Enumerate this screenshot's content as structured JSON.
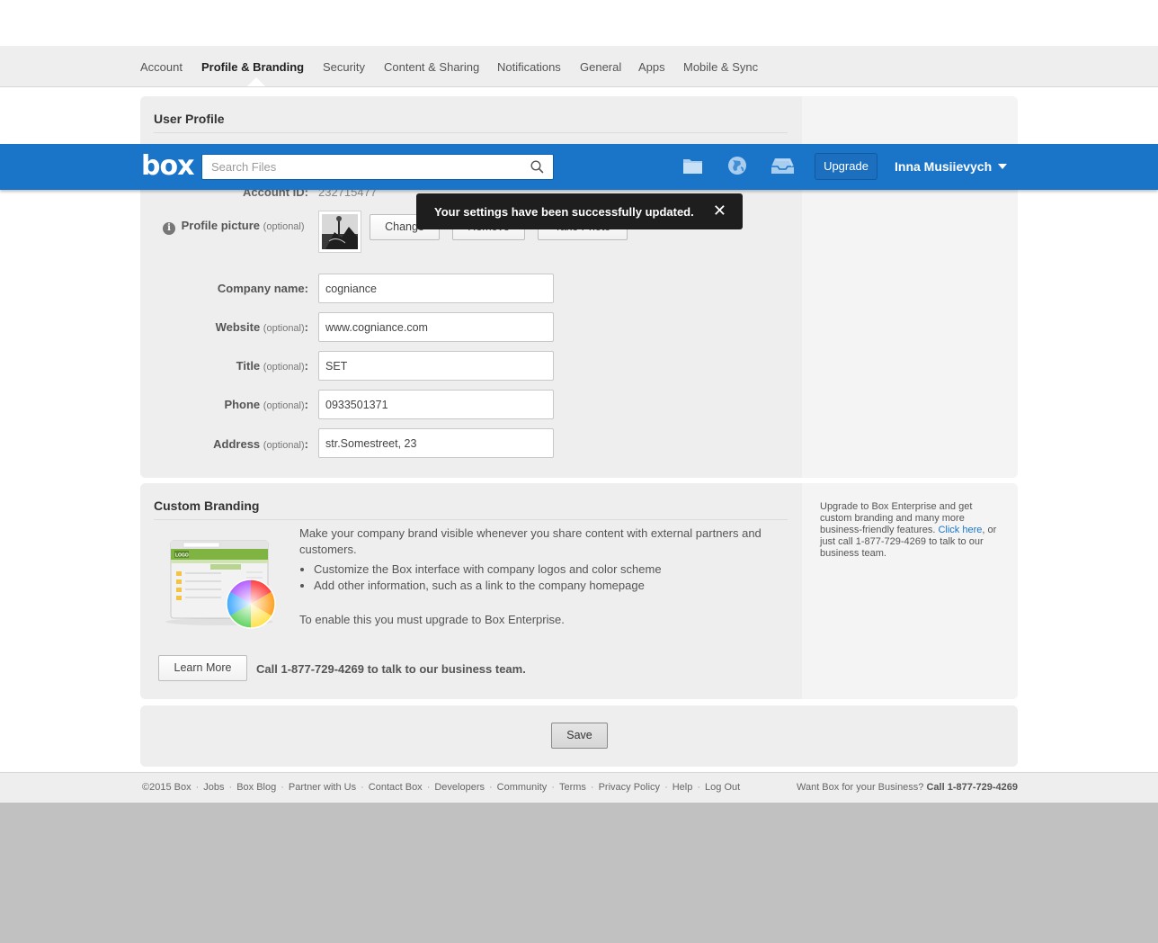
{
  "settings_tabs": [
    {
      "label": "Account"
    },
    {
      "label": "Profile & Branding"
    },
    {
      "label": "Security"
    },
    {
      "label": "Content & Sharing"
    },
    {
      "label": "Notifications"
    },
    {
      "label": "General"
    },
    {
      "label": "Apps"
    },
    {
      "label": "Mobile & Sync"
    }
  ],
  "user_profile": {
    "title": "User Profile",
    "account_id_label": "Account ID:",
    "account_id_value": "232715477",
    "profile_picture_label": "Profile picture",
    "optional": "(optional)",
    "change_label": "Change",
    "remove_label": "Remove",
    "take_photo_label": "Take Photo",
    "fields": {
      "company": {
        "label": "Company name:",
        "value": "cogniance"
      },
      "website": {
        "label": "Website",
        "suffix": ":",
        "value": "www.cogniance.com"
      },
      "title": {
        "label": "Title",
        "suffix": ":",
        "value": "SET"
      },
      "phone": {
        "label": "Phone",
        "suffix": ":",
        "value": "0933501371"
      },
      "address": {
        "label": "Address",
        "suffix": ":",
        "value": "str.Somestreet, 23"
      }
    }
  },
  "header": {
    "logo": "box",
    "search_placeholder": "Search Files",
    "upgrade_label": "Upgrade",
    "user_name": "Inna Musiievych"
  },
  "toast": {
    "message": "Your settings have been successfully updated.",
    "close_glyph": "✕"
  },
  "custom_branding": {
    "title": "Custom Branding",
    "description": "Make your company brand visible whenever you share content with external partners and customers.",
    "bullets": [
      "Customize the Box interface with company logos and color scheme",
      "Add other information, such as a link to the company homepage"
    ],
    "enable_note": "To enable this you must upgrade to Box Enterprise.",
    "learn_more_label": "Learn More",
    "call_note": "Call 1-877-729-4269 to talk to our business team.",
    "side_note_before": "Upgrade to Box Enterprise and get custom branding and many more business-friendly features. ",
    "side_note_link": "Click here",
    "side_note_after": ", or just call 1-877-729-4269 to talk to our business team.",
    "illustration_logo": "LOGO"
  },
  "save_label": "Save",
  "footer": {
    "links": [
      "©2015 Box",
      "Jobs",
      "Box Blog",
      "Partner with Us",
      "Contact Box",
      "Developers",
      "Community",
      "Terms",
      "Privacy Policy",
      "Help",
      "Log Out"
    ],
    "separator": "·",
    "biz_question": "Want Box for your Business?",
    "biz_call": "Call 1-877-729-4269"
  },
  "colors": {
    "brand_blue": "#1a75c9",
    "toast_bg": "#1e1e1e",
    "link": "#1a75c9"
  }
}
